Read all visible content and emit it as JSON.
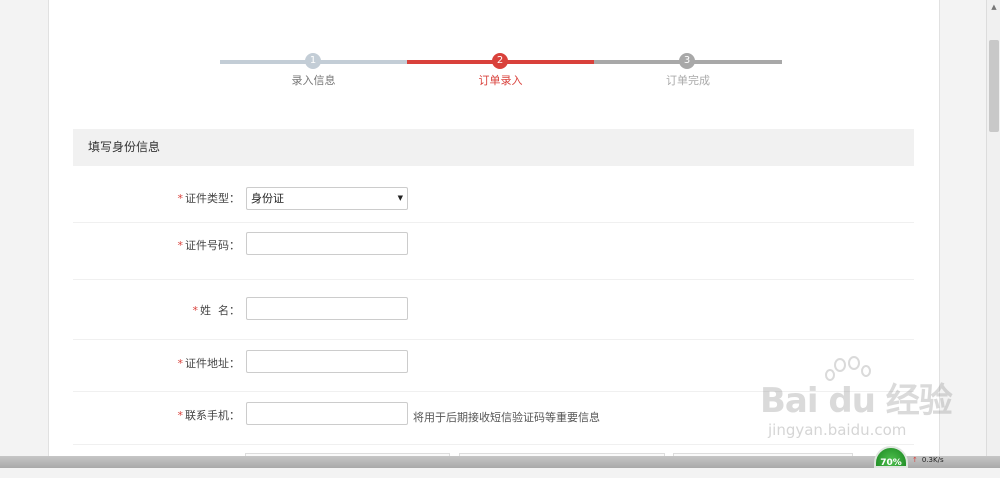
{
  "stepper": {
    "steps": [
      {
        "num": "1",
        "label": "录入信息",
        "state": "done"
      },
      {
        "num": "2",
        "label": "订单录入",
        "state": "active"
      },
      {
        "num": "3",
        "label": "订单完成",
        "state": "pending"
      }
    ]
  },
  "form": {
    "section_title": "填写身份信息",
    "required_mark": "*",
    "fields": {
      "id_type": {
        "label": "证件类型：",
        "value": "身份证"
      },
      "id_number": {
        "label": "证件号码：",
        "value": ""
      },
      "name": {
        "label": "姓  名：",
        "value": ""
      },
      "address": {
        "label": "证件地址：",
        "value": ""
      },
      "phone": {
        "label": "联系手机：",
        "value": "",
        "hint": "将用于后期接收短信验证码等重要信息"
      }
    }
  },
  "system": {
    "gauge": "70%",
    "netspeed": "0.3K/s",
    "netspeed_arrow": "↑"
  },
  "watermark": {
    "main": "Bai du 经验",
    "sub": "jingyan.baidu.com"
  },
  "colors": {
    "accent": "#d9413b",
    "done": "#c3cdd6",
    "pending": "#a8a8a8"
  }
}
